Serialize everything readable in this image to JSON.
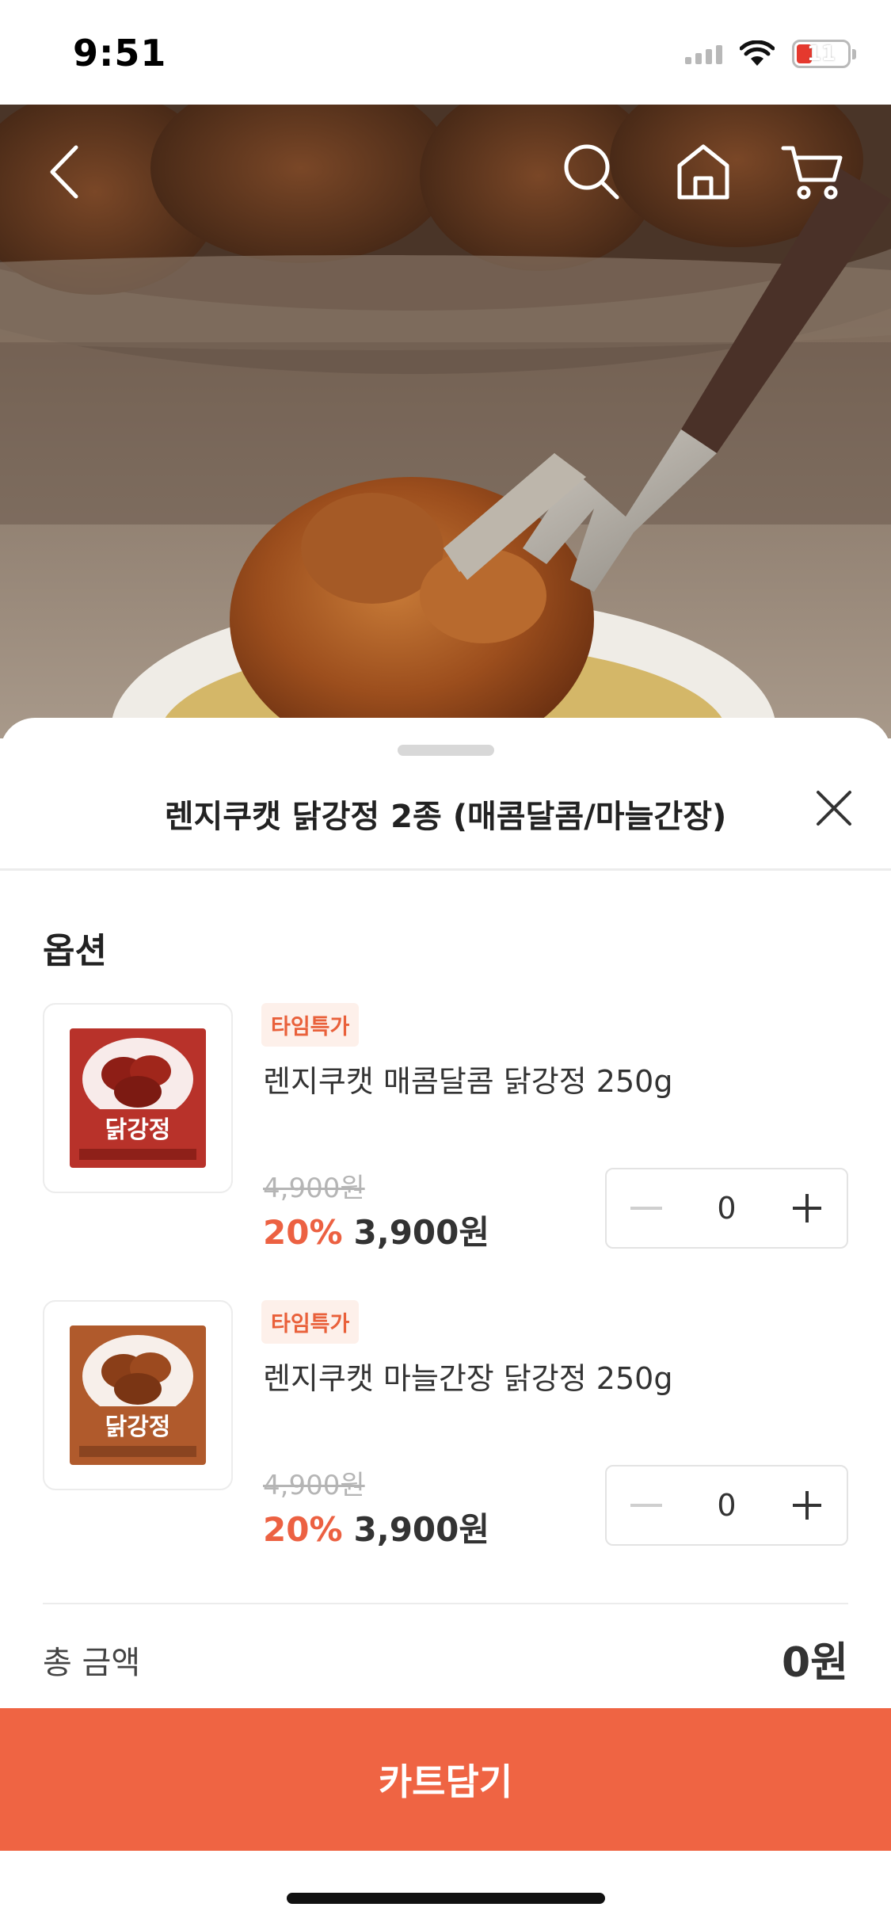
{
  "status_bar": {
    "time": "9:51",
    "battery": "11"
  },
  "header": {
    "back_icon": "chevron-left-icon",
    "search_icon": "search-icon",
    "home_icon": "home-icon",
    "cart_icon": "cart-icon"
  },
  "sheet": {
    "title": "렌지쿠캣 닭강정 2종 (매콤달콤/마늘간장)",
    "section_title": "옵션",
    "options": [
      {
        "badge": "타임특가",
        "name": "렌지쿠캣 매콤달콤 닭강정 250g",
        "original_price": "4,900원",
        "discount": "20%",
        "price": "3,900원",
        "quantity": "0",
        "package_color": "#b8322a"
      },
      {
        "badge": "타임특가",
        "name": "렌지쿠캣 마늘간장 닭강정 250g",
        "original_price": "4,900원",
        "discount": "20%",
        "price": "3,900원",
        "quantity": "0",
        "package_color": "#b05a2c"
      }
    ],
    "total_label": "총 금액",
    "total_value": "0원",
    "cta_label": "카트담기"
  },
  "colors": {
    "accent": "#ef6443",
    "discount": "#ec6142",
    "badge_bg": "#fdf0ea"
  }
}
